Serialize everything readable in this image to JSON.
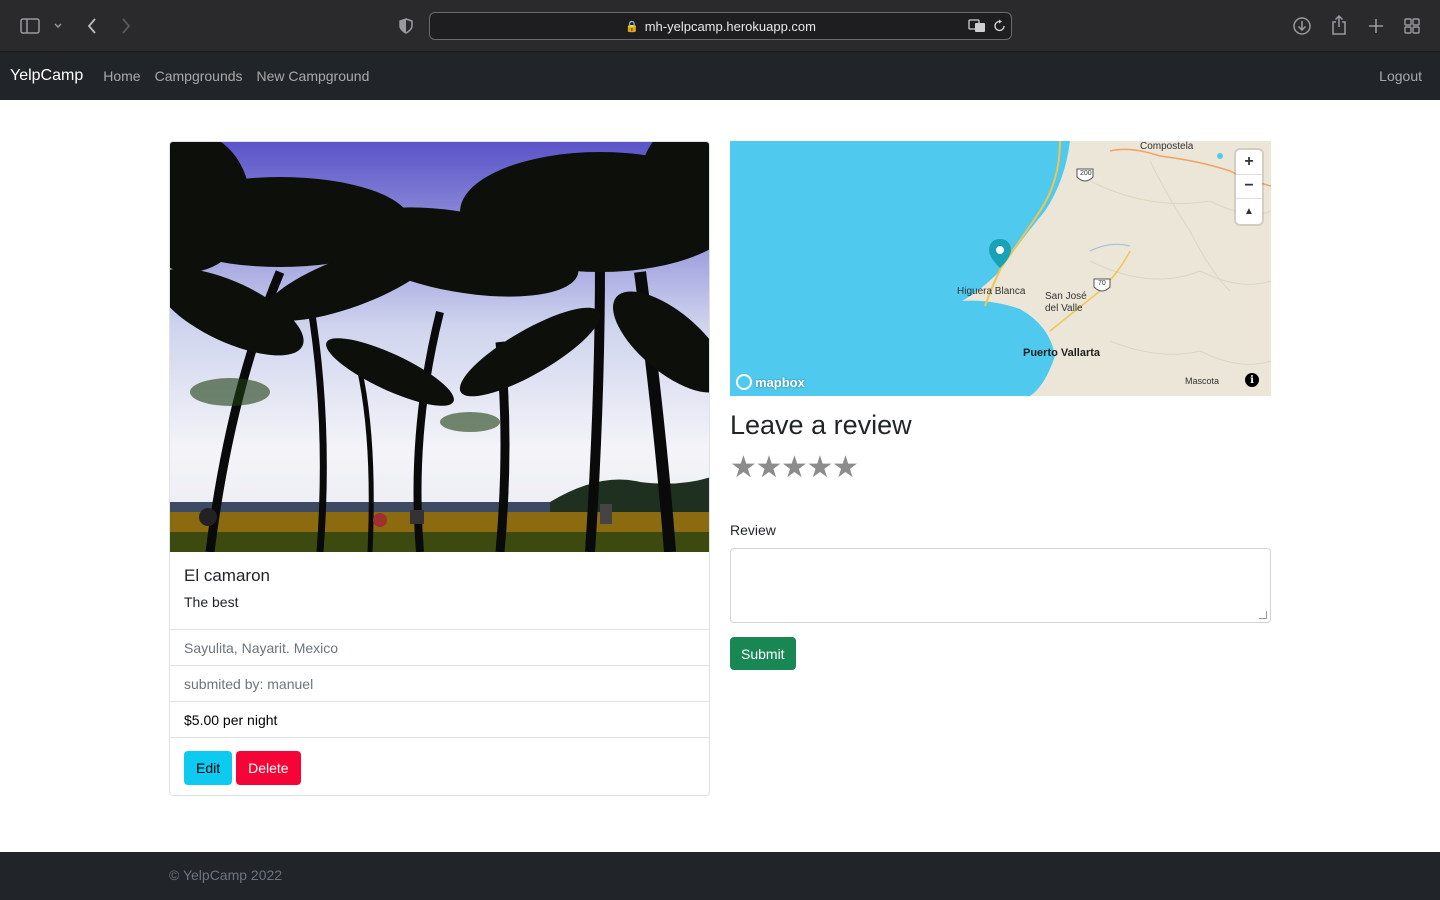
{
  "browser": {
    "url": "mh-yelpcamp.herokuapp.com"
  },
  "navbar": {
    "brand": "YelpCamp",
    "links": [
      "Home",
      "Campgrounds",
      "New Campground"
    ],
    "logout": "Logout"
  },
  "campground": {
    "title": "El camaron",
    "description": "The best",
    "location": "Sayulita, Nayarit. Mexico",
    "author": "submited by: manuel",
    "price": "$5.00 per night",
    "edit_label": "Edit",
    "delete_label": "Delete"
  },
  "map": {
    "labels": {
      "compostela": "Compostela",
      "higuera": "Higuera Blanca",
      "sanjose1": "San José",
      "sanjose2": "del Valle",
      "vallarta": "Puerto Vallarta",
      "mascota": "Mascota",
      "hw200": "200",
      "hw70": "70"
    },
    "zoom_in": "+",
    "zoom_out": "−",
    "compass": "▲",
    "logo": "mapbox",
    "info": "i"
  },
  "review": {
    "heading": "Leave a review",
    "stars": [
      "★",
      "★",
      "★",
      "★",
      "★"
    ],
    "label": "Review",
    "submit": "Submit"
  },
  "footer": {
    "text": "© YelpCamp 2022"
  },
  "colors": {
    "navbar": "#212529",
    "info": "#0dcaf0",
    "danger": "#f50537",
    "success": "#198754",
    "water": "#4fc9ee"
  }
}
